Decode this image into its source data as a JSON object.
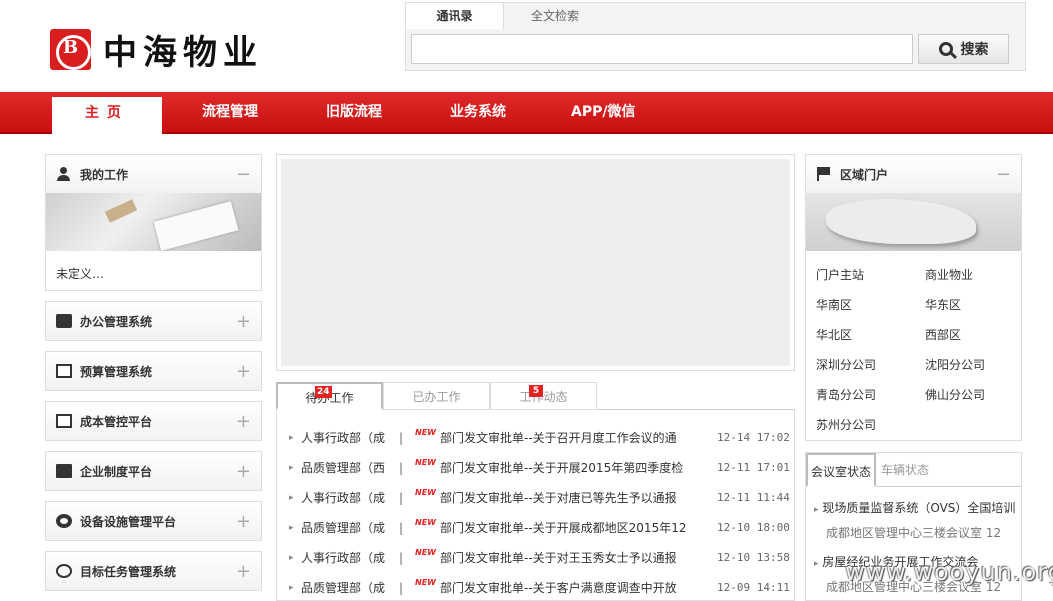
{
  "logo": {
    "text": "中海物业"
  },
  "search": {
    "tab_contacts": "通讯录",
    "tab_fulltext": "全文检索",
    "button": "搜索",
    "value": ""
  },
  "nav": {
    "home": "主页",
    "items": [
      "流程管理",
      "旧版流程",
      "业务系统",
      "APP/微信"
    ]
  },
  "my_work": {
    "title": "我的工作",
    "toggle": "−",
    "undefined_text": "未定义…"
  },
  "left_panels": [
    {
      "title": "办公管理系统",
      "icon": "briefcase-icon",
      "toggle": "+"
    },
    {
      "title": "预算管理系统",
      "icon": "calculator-icon",
      "toggle": "+"
    },
    {
      "title": "成本管控平台",
      "icon": "calculator-icon",
      "toggle": "+"
    },
    {
      "title": "企业制度平台",
      "icon": "book-icon",
      "toggle": "+"
    },
    {
      "title": "设备设施管理平台",
      "icon": "gear-icon",
      "toggle": "+"
    },
    {
      "title": "目标任务管理系统",
      "icon": "compass-icon",
      "toggle": "+"
    }
  ],
  "work_tabs": [
    {
      "label": "待办工作",
      "badge": "24"
    },
    {
      "label": "已办工作",
      "badge": ""
    },
    {
      "label": "工作动态",
      "badge": "5"
    }
  ],
  "work_items": [
    {
      "dept": "人事行政部（成",
      "sep": "|",
      "new": "NEW",
      "title": "部门发文审批单--关于召开月度工作会议的通",
      "time": "12-14 17:02"
    },
    {
      "dept": "品质管理部（西",
      "sep": "|",
      "new": "NEW",
      "title": "部门发文审批单--关于开展2015年第四季度检",
      "time": "12-11 17:01"
    },
    {
      "dept": "人事行政部（成",
      "sep": "|",
      "new": "NEW",
      "title": "部门发文审批单--关于对唐已等先生予以通报",
      "time": "12-11 11:44"
    },
    {
      "dept": "品质管理部（成",
      "sep": "|",
      "new": "NEW",
      "title": "部门发文审批单--关于开展成都地区2015年12",
      "time": "12-10 18:00"
    },
    {
      "dept": "人事行政部（成",
      "sep": "|",
      "new": "NEW",
      "title": "部门发文审批单--关于对王玉秀女士予以通报",
      "time": "12-10 13:58"
    },
    {
      "dept": "品质管理部（成",
      "sep": "|",
      "new": "NEW",
      "title": "部门发文审批单--关于客户满意度调查中开放",
      "time": "12-09 14:11"
    }
  ],
  "region": {
    "title": "区域门户",
    "toggle": "−",
    "links": [
      "门户主站",
      "商业物业",
      "华南区",
      "华东区",
      "华北区",
      "西部区",
      "深圳分公司",
      "沈阳分公司",
      "青岛分公司",
      "佛山分公司",
      "苏州分公司"
    ]
  },
  "meeting": {
    "tabs": [
      "会议室状态",
      "车辆状态"
    ],
    "items": [
      {
        "title": "现场质量监督系统（OVS）全国培训",
        "sub": "成都地区管理中心三楼会议室  12"
      },
      {
        "title": "房屋经纪业务开展工作交流会",
        "sub": "成都地区管理中心三楼会议室  12"
      }
    ]
  },
  "watermark": "www.wooyun.org"
}
